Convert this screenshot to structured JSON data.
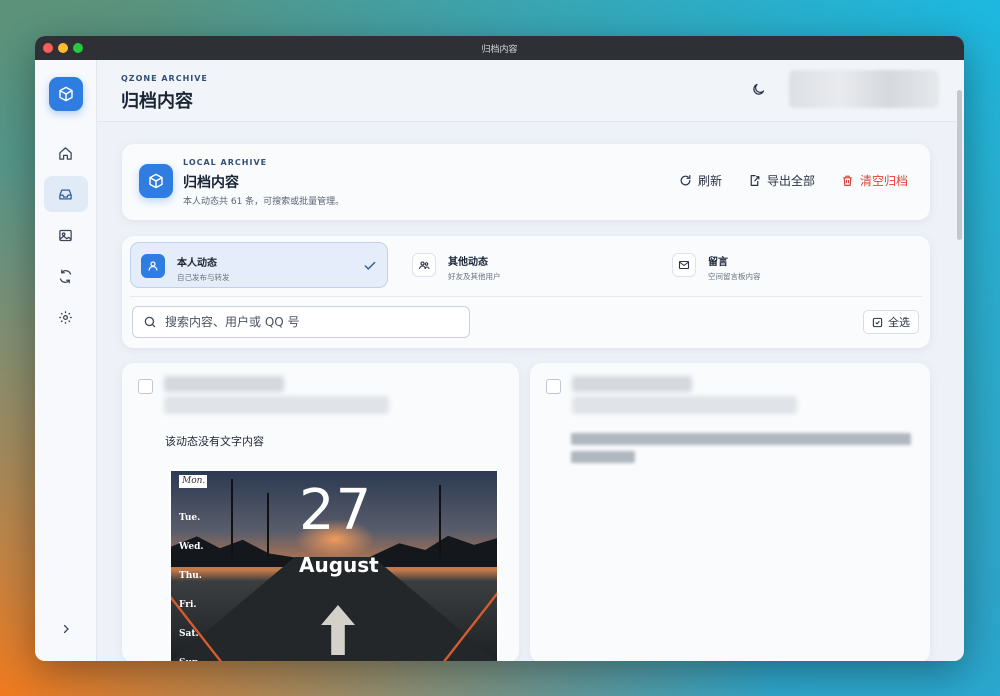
{
  "window": {
    "title": "归档内容"
  },
  "header": {
    "eyebrow": "QZONE ARCHIVE",
    "title": "归档内容"
  },
  "summary": {
    "eyebrow": "LOCAL ARCHIVE",
    "title": "归档内容",
    "desc": "本人动态共 61 条，可搜索或批量管理。",
    "actions": {
      "refresh": "刷新",
      "export": "导出全部",
      "clear": "清空归档"
    }
  },
  "tabs": [
    {
      "name": "本人动态",
      "desc": "自己发布与转发"
    },
    {
      "name": "其他动态",
      "desc": "好友及其他用户"
    },
    {
      "name": "留言",
      "desc": "空间留言板内容"
    }
  ],
  "search": {
    "placeholder": "搜索内容、用户或 QQ 号"
  },
  "select_all": "全选",
  "posts": [
    {
      "text": "该动态没有文字内容",
      "image": {
        "badge": "Mon.",
        "days": [
          "Tue.",
          "Wed.",
          "Thu.",
          "Fri.",
          "Sat.",
          "Sun."
        ],
        "day": "27",
        "month": "August"
      }
    },
    {
      "text": ""
    }
  ],
  "colors": {
    "accent": "#2f7de1",
    "danger": "#e0463d",
    "text": "#1b2535"
  }
}
